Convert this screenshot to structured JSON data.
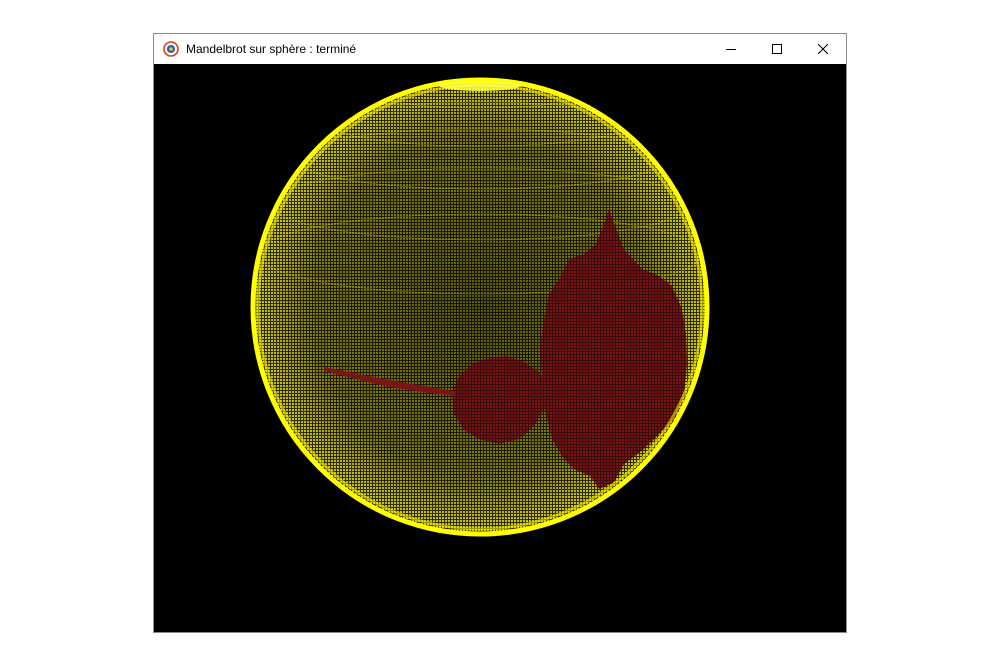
{
  "window": {
    "title": "Mandelbrot sur sphère : terminé",
    "app_icon": "app-logo-icon",
    "controls": [
      {
        "name": "minimize-button",
        "icon": "minimize-icon"
      },
      {
        "name": "maximize-button",
        "icon": "maximize-icon"
      },
      {
        "name": "close-button",
        "icon": "close-icon"
      }
    ]
  },
  "render": {
    "background_color": "#000000",
    "sphere_color": "#ffff00",
    "fractal_color": "#6b0f0f"
  }
}
